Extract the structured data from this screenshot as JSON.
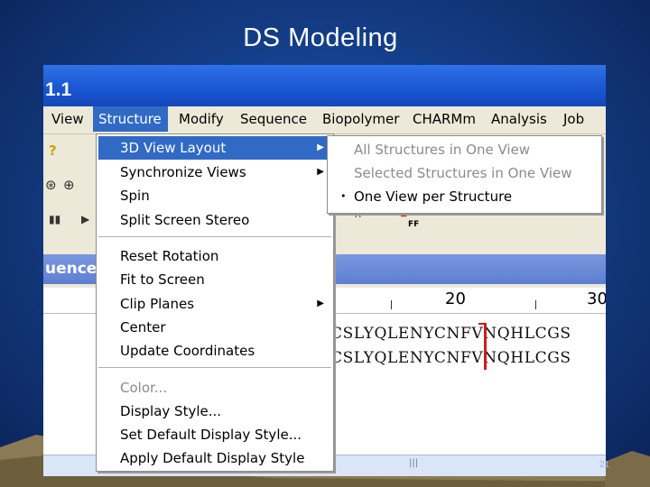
{
  "slide": {
    "title": "DS Modeling",
    "page_number": "21"
  },
  "window": {
    "title": "1.1"
  },
  "menubar": {
    "items": [
      {
        "label": "View"
      },
      {
        "label": "Structure"
      },
      {
        "label": "Modify"
      },
      {
        "label": "Sequence"
      },
      {
        "label": "Biopolymer"
      },
      {
        "label": "CHARMm"
      },
      {
        "label": "Analysis"
      },
      {
        "label": "Job Co"
      }
    ]
  },
  "structure_menu": {
    "items": [
      {
        "label": "3D View Layout"
      },
      {
        "label": "Synchronize Views"
      },
      {
        "label": "Spin"
      },
      {
        "label": "Split Screen Stereo"
      },
      {
        "label": "Reset Rotation"
      },
      {
        "label": "Fit to Screen"
      },
      {
        "label": "Clip Planes"
      },
      {
        "label": "Center"
      },
      {
        "label": "Update Coordinates"
      },
      {
        "label": "Color..."
      },
      {
        "label": "Display Style..."
      },
      {
        "label": "Set Default Display Style..."
      },
      {
        "label": "Apply Default Display Style"
      }
    ]
  },
  "layout_submenu": {
    "items": [
      {
        "label": "All Structures in One View"
      },
      {
        "label": "Selected Structures in One View"
      },
      {
        "label": "One View per Structure",
        "selected_marker": "•"
      }
    ]
  },
  "sequence_view": {
    "pane_title": "uence",
    "ruler": {
      "mark_20": "20",
      "mark_30": "30"
    },
    "lines": [
      "CSLYQLENYCNFVNQHLCGS",
      "CSLYQLENYCNFVNQHLCGS"
    ]
  },
  "toolbar_buttons": {
    "ff1": "FF",
    "ff2": "FF"
  },
  "colors": {
    "highlight": "#316ac5",
    "titlebar": "#1a55d1",
    "pane_title": "#6786d6",
    "cursor": "#d11a1a"
  }
}
